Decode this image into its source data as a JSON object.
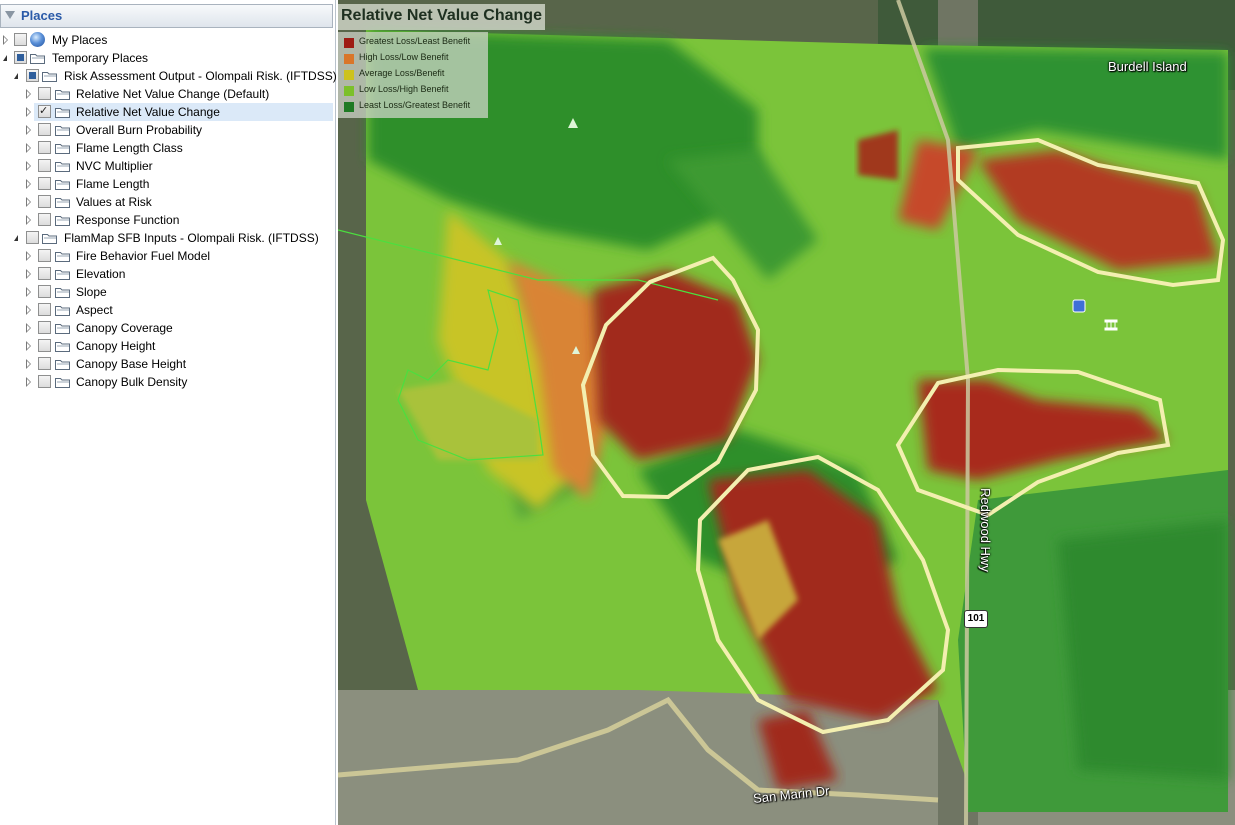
{
  "places": {
    "header": "Places",
    "items": [
      {
        "label": "My Places",
        "icon": "globe-icon"
      },
      {
        "label": "Temporary Places",
        "icon": "folder-icon"
      },
      {
        "label": "Risk Assessment Output - Olompali Risk. (IFTDSS)",
        "icon": "folder-icon"
      },
      {
        "label": "Relative Net Value Change (Default)",
        "icon": "folder-icon",
        "checked": false
      },
      {
        "label": "Relative Net Value Change",
        "icon": "folder-icon",
        "checked": true,
        "selected": true
      },
      {
        "label": "Overall Burn Probability",
        "icon": "folder-icon",
        "checked": false
      },
      {
        "label": "Flame Length Class",
        "icon": "folder-icon",
        "checked": false
      },
      {
        "label": "NVC Multiplier",
        "icon": "folder-icon",
        "checked": false
      },
      {
        "label": "Flame Length",
        "icon": "folder-icon",
        "checked": false
      },
      {
        "label": "Values at Risk",
        "icon": "folder-icon",
        "checked": false
      },
      {
        "label": "Response Function",
        "icon": "folder-icon",
        "checked": false
      },
      {
        "label": "FlamMap SFB Inputs - Olompali Risk. (IFTDSS)",
        "icon": "folder-icon",
        "checked": false
      },
      {
        "label": "Fire Behavior Fuel Model",
        "icon": "folder-icon",
        "checked": false
      },
      {
        "label": "Elevation",
        "icon": "folder-icon",
        "checked": false
      },
      {
        "label": "Slope",
        "icon": "folder-icon",
        "checked": false
      },
      {
        "label": "Aspect",
        "icon": "folder-icon",
        "checked": false
      },
      {
        "label": "Canopy Coverage",
        "icon": "folder-icon",
        "checked": false
      },
      {
        "label": "Canopy Height",
        "icon": "folder-icon",
        "checked": false
      },
      {
        "label": "Canopy Base Height",
        "icon": "folder-icon",
        "checked": false
      },
      {
        "label": "Canopy Bulk Density",
        "icon": "folder-icon",
        "checked": false
      }
    ]
  },
  "map": {
    "title": "Relative Net Value Change",
    "legend": [
      {
        "label": "Greatest Loss/Least Benefit",
        "color": "#9e1b14"
      },
      {
        "label": "High Loss/Low Benefit",
        "color": "#d9762a"
      },
      {
        "label": "Average Loss/Benefit",
        "color": "#cdc21e"
      },
      {
        "label": "Low Loss/High Benefit",
        "color": "#7cc02a"
      },
      {
        "label": "Least Loss/Greatest Benefit",
        "color": "#1f7a24"
      }
    ],
    "labels": {
      "island": "Burdell Island",
      "highway": "Redwood Hwy",
      "shield": "101",
      "street": "San Marin Dr"
    }
  }
}
